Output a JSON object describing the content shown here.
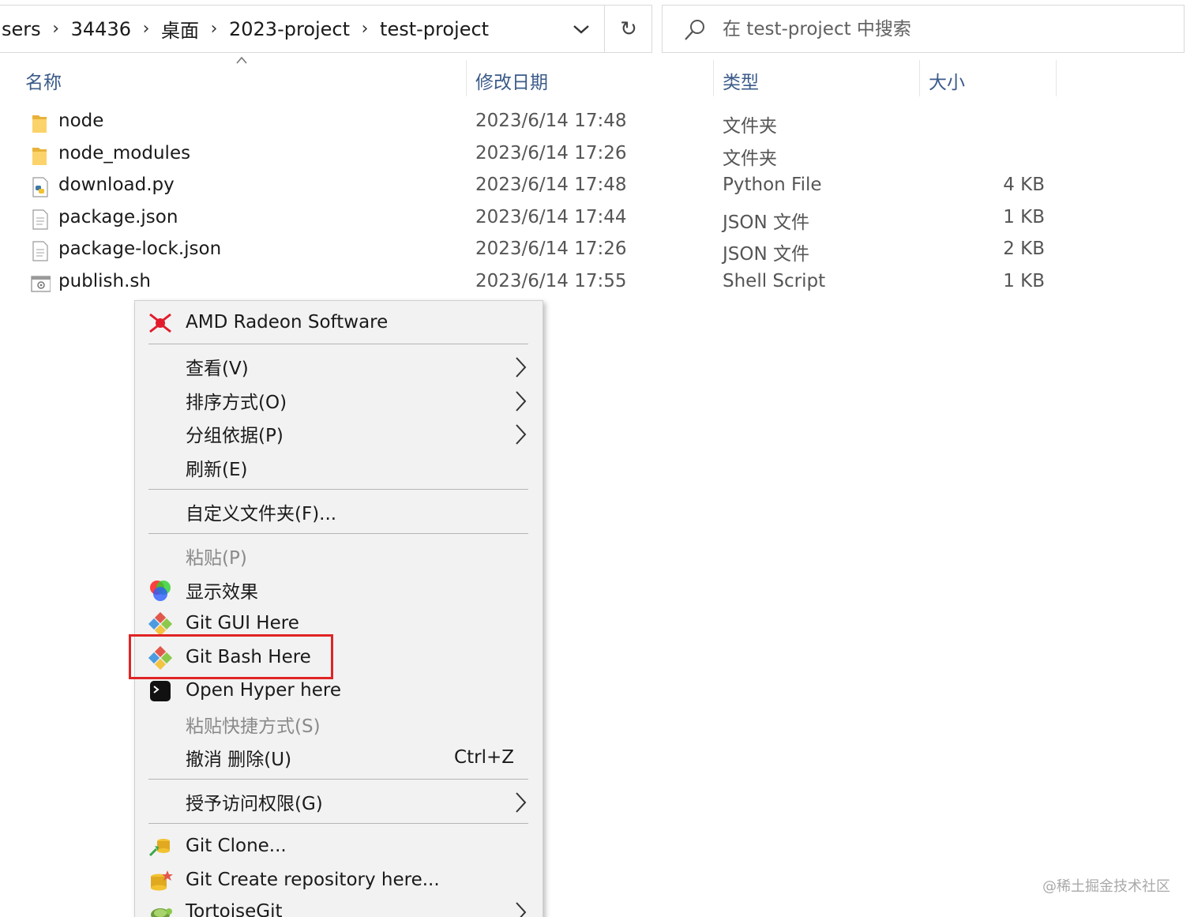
{
  "address_bar": {
    "crumbs": [
      "sers",
      "34436",
      "桌面",
      "2023-project",
      "test-project"
    ]
  },
  "search": {
    "placeholder": "在 test-project 中搜索"
  },
  "columns": {
    "name": "名称",
    "date": "修改日期",
    "type": "类型",
    "size": "大小"
  },
  "files": [
    {
      "name": "node",
      "date": "2023/6/14 17:48",
      "type": "文件夹",
      "size": "",
      "icon": "folder-icon"
    },
    {
      "name": "node_modules",
      "date": "2023/6/14 17:26",
      "type": "文件夹",
      "size": "",
      "icon": "folder-icon"
    },
    {
      "name": "download.py",
      "date": "2023/6/14 17:48",
      "type": "Python File",
      "size": "4 KB",
      "icon": "python-file-icon"
    },
    {
      "name": "package.json",
      "date": "2023/6/14 17:44",
      "type": "JSON 文件",
      "size": "1 KB",
      "icon": "json-file-icon"
    },
    {
      "name": "package-lock.json",
      "date": "2023/6/14 17:26",
      "type": "JSON 文件",
      "size": "2 KB",
      "icon": "json-file-icon"
    },
    {
      "name": "publish.sh",
      "date": "2023/6/14 17:55",
      "type": "Shell Script",
      "size": "1 KB",
      "icon": "shell-script-icon"
    }
  ],
  "context_menu": {
    "items": [
      {
        "label": "AMD Radeon Software",
        "icon": "amd-radeon-icon"
      },
      {
        "label": "查看(V)",
        "submenu": true
      },
      {
        "label": "排序方式(O)",
        "submenu": true
      },
      {
        "label": "分组依据(P)",
        "submenu": true
      },
      {
        "label": "刷新(E)"
      },
      {
        "label": "自定义文件夹(F)..."
      },
      {
        "label": "粘贴(P)",
        "disabled": true
      },
      {
        "label": "显示效果",
        "icon": "color-wheel-icon"
      },
      {
        "label": "Git GUI Here",
        "icon": "git-gui-icon"
      },
      {
        "label": "Git Bash Here",
        "icon": "git-bash-icon"
      },
      {
        "label": "Open Hyper here",
        "icon": "hyper-terminal-icon"
      },
      {
        "label": "粘贴快捷方式(S)",
        "disabled": true
      },
      {
        "label": "撤消 删除(U)",
        "shortcut": "Ctrl+Z"
      },
      {
        "label": "授予访问权限(G)",
        "submenu": true
      },
      {
        "label": "Git Clone...",
        "icon": "tortoisegit-clone-icon"
      },
      {
        "label": "Git Create repository here...",
        "icon": "tortoisegit-create-repo-icon"
      },
      {
        "label": "TortoiseGit",
        "icon": "tortoisegit-icon",
        "submenu": true
      }
    ]
  },
  "colors": {
    "highlight_box": "#e02424",
    "column_header_text": "#3b5b8a",
    "menu_background": "#f2f2f2"
  },
  "watermark": "@稀土掘金技术社区"
}
